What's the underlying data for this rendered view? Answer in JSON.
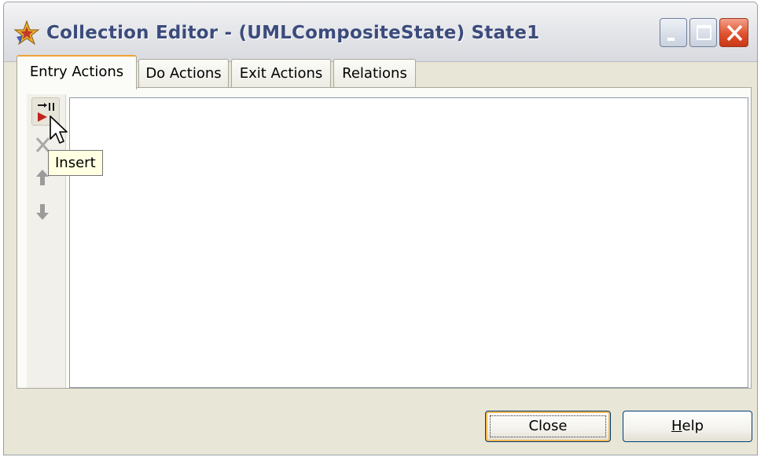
{
  "window": {
    "title": "Collection Editor - (UMLCompositeState) State1",
    "app_icon": "star-icon",
    "controls": [
      "minimize-icon",
      "maximize-icon",
      "close-icon"
    ]
  },
  "tabs": [
    {
      "label": "Entry Actions",
      "active": true
    },
    {
      "label": "Do Actions",
      "active": false
    },
    {
      "label": "Exit Actions",
      "active": false
    },
    {
      "label": "Relations",
      "active": false
    }
  ],
  "toolbar": {
    "tools": [
      {
        "name": "insert",
        "icon": "insert-icon",
        "enabled": true
      },
      {
        "name": "delete",
        "icon": "delete-icon",
        "enabled": false
      },
      {
        "name": "move-up",
        "icon": "arrow-up-icon",
        "enabled": false
      },
      {
        "name": "move-down",
        "icon": "arrow-down-icon",
        "enabled": false
      }
    ],
    "tooltip": "Insert"
  },
  "buttons": {
    "close_label": "Close",
    "help_label_mnemonic": "H",
    "help_label_rest": "elp"
  },
  "colors": {
    "title_text": "#3b4b7c",
    "active_tab_accent": "#f0a33a",
    "close_button": "#e0522e",
    "window_face": "#e8e6d7"
  }
}
